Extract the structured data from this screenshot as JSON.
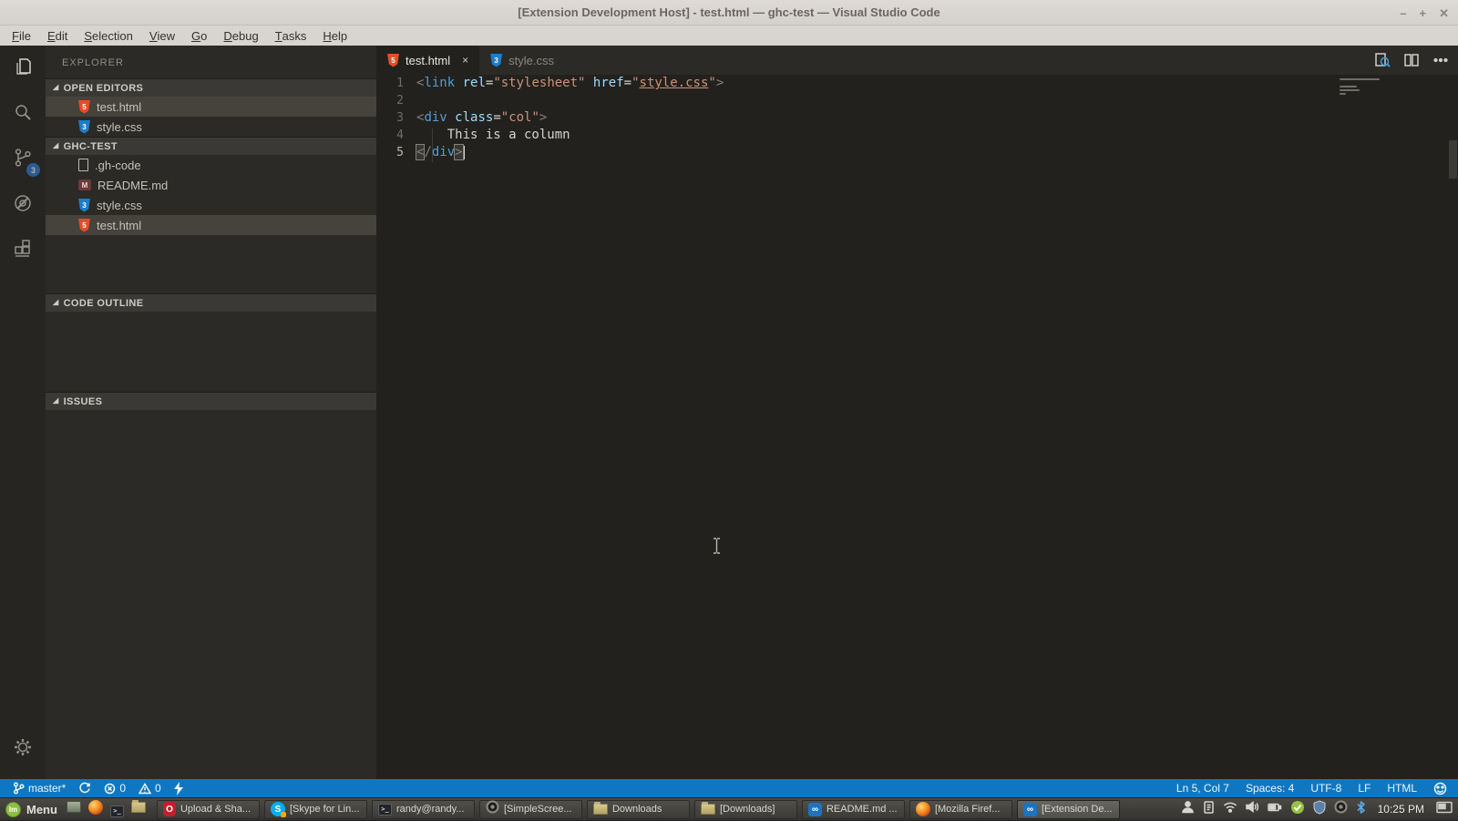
{
  "window": {
    "title": "[Extension Development Host] - test.html — ghc-test — Visual Studio Code",
    "minimize": "–",
    "maximize": "+",
    "close": "✕"
  },
  "menu": {
    "items": [
      "File",
      "Edit",
      "Selection",
      "View",
      "Go",
      "Debug",
      "Tasks",
      "Help"
    ]
  },
  "activity_bar": {
    "items": [
      {
        "icon": "files",
        "active": true
      },
      {
        "icon": "search"
      },
      {
        "icon": "source-control",
        "badge": "3"
      },
      {
        "icon": "debug"
      },
      {
        "icon": "extensions"
      }
    ],
    "bottom": [
      {
        "icon": "gear"
      }
    ]
  },
  "sidebar": {
    "title": "EXPLORER",
    "open_editors": {
      "label": "OPEN EDITORS",
      "files": [
        {
          "name": "test.html",
          "icon": "html",
          "selected": true
        },
        {
          "name": "style.css",
          "icon": "css"
        }
      ]
    },
    "folder": {
      "label": "GHC-TEST",
      "files": [
        {
          "name": ".gh-code",
          "icon": "file"
        },
        {
          "name": "README.md",
          "icon": "md"
        },
        {
          "name": "style.css",
          "icon": "css"
        },
        {
          "name": "test.html",
          "icon": "html",
          "selected": true
        }
      ]
    },
    "extra_sections": [
      {
        "label": "CODE OUTLINE"
      },
      {
        "label": "ISSUES"
      }
    ]
  },
  "editor": {
    "tabs": [
      {
        "label": "test.html",
        "icon": "html",
        "active": true,
        "close_label": "×"
      },
      {
        "label": "style.css",
        "icon": "css",
        "active": false
      }
    ],
    "actions": [
      {
        "icon": "preview"
      },
      {
        "icon": "split-editor"
      },
      {
        "icon": "more"
      }
    ],
    "code": {
      "lines": [
        {
          "num": "1",
          "tokens": [
            [
              "<",
              "pun"
            ],
            [
              "link",
              "tag"
            ],
            [
              " ",
              "txt"
            ],
            [
              "rel",
              "attr"
            ],
            [
              "=",
              "eq"
            ],
            [
              "\"stylesheet\"",
              "str"
            ],
            [
              " ",
              "txt"
            ],
            [
              "href",
              "attr"
            ],
            [
              "=",
              "eq"
            ],
            [
              "\"",
              "str"
            ],
            [
              "style.css",
              "lnk"
            ],
            [
              "\"",
              "str"
            ],
            [
              ">",
              "pun"
            ]
          ]
        },
        {
          "num": "2",
          "tokens": []
        },
        {
          "num": "3",
          "tokens": [
            [
              "<",
              "pun"
            ],
            [
              "div",
              "tag"
            ],
            [
              " ",
              "txt"
            ],
            [
              "class",
              "attr"
            ],
            [
              "=",
              "eq"
            ],
            [
              "\"col\"",
              "str"
            ],
            [
              ">",
              "pun"
            ]
          ]
        },
        {
          "num": "4",
          "tokens": [
            [
              "    This is a column",
              "txt"
            ]
          ]
        },
        {
          "num": "5",
          "tokens": [
            [
              "<",
              "pun mb"
            ],
            [
              "/",
              "pun"
            ],
            [
              "div",
              "tag"
            ],
            [
              ">",
              "pun mb"
            ]
          ],
          "cursor": true,
          "current": true
        }
      ]
    }
  },
  "status_bar": {
    "left": [
      {
        "icon": "branch",
        "label": "master*",
        "name": "git-branch"
      },
      {
        "icon": "sync",
        "label": "",
        "name": "sync"
      },
      {
        "icon": "error",
        "label": "0",
        "name": "errors"
      },
      {
        "icon": "warning",
        "label": "0",
        "name": "warnings"
      },
      {
        "icon": "bolt",
        "label": "",
        "name": "feedback-bolt"
      }
    ],
    "right": [
      {
        "label": "Ln 5, Col 7",
        "name": "cursor-position"
      },
      {
        "label": "Spaces: 4",
        "name": "indentation"
      },
      {
        "label": "UTF-8",
        "name": "encoding"
      },
      {
        "label": "LF",
        "name": "eol"
      },
      {
        "label": "HTML",
        "name": "language-mode"
      },
      {
        "icon": "smiley",
        "label": "",
        "name": "feedback-smiley"
      }
    ]
  },
  "taskbar": {
    "menu": {
      "icon": "mint-logo",
      "label": "Menu"
    },
    "launchers": [
      {
        "icon": "show-desktop"
      },
      {
        "icon": "firefox"
      },
      {
        "icon": "terminal"
      },
      {
        "icon": "folder"
      }
    ],
    "windows": [
      {
        "icon": "opera",
        "label": "Upload & Sha...",
        "active": false
      },
      {
        "icon": "skype",
        "label": "[Skype for Lin...",
        "active": false
      },
      {
        "icon": "terminal",
        "label": "randy@randy...",
        "active": false
      },
      {
        "icon": "recorder",
        "label": "[SimpleScree...",
        "active": false
      },
      {
        "icon": "folder",
        "label": "Downloads",
        "active": false
      },
      {
        "icon": "folder",
        "label": "[Downloads]",
        "active": false
      },
      {
        "icon": "vscode",
        "label": "README.md ...",
        "active": false
      },
      {
        "icon": "firefox",
        "label": "[Mozilla Firef...",
        "active": false
      },
      {
        "icon": "vscode",
        "label": "[Extension De...",
        "active": true
      }
    ],
    "tray": [
      {
        "icon": "user"
      },
      {
        "icon": "clipboard"
      },
      {
        "icon": "wifi"
      },
      {
        "icon": "volume"
      },
      {
        "icon": "battery"
      },
      {
        "icon": "updates"
      },
      {
        "icon": "shield"
      },
      {
        "icon": "recorder-tray"
      },
      {
        "icon": "bluetooth"
      }
    ],
    "clock": "10:25 PM",
    "workspace_icon": "workspaces"
  }
}
